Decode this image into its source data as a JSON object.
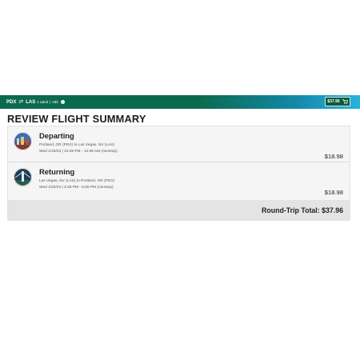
{
  "header": {
    "origin": "PDX",
    "destination": "LAS",
    "passengers": "1 adult",
    "edit_label": "edit",
    "cart_total": "$37.96",
    "icons": [
      "swap-arrows-icon",
      "info-icon",
      "cart-icon"
    ]
  },
  "page_title": "REVIEW FLIGHT SUMMARY",
  "segments": [
    {
      "title": "Departing",
      "route": "Portland, OR (PDX) to Las Vegas, NV (LAS)",
      "time": "Wed 1/18/23 | 10:25 PM - 12:38 AM (nonstop)",
      "price": "$18.98"
    },
    {
      "title": "Returning",
      "route": "Las Vegas, NV (LAS) to Portland, OR (PDX)",
      "time": "Wed 1/25/23 | 3:28 PM - 5:55 PM (nonstop)",
      "price": "$18.98"
    }
  ],
  "total": {
    "label": "Round-Trip Total: $37.96"
  },
  "colors": {
    "brand_green": "#0b6a4d",
    "brand_blue": "#26b3e0",
    "panel_bg": "#f5f5f5",
    "total_bg": "#e4e4e4"
  }
}
